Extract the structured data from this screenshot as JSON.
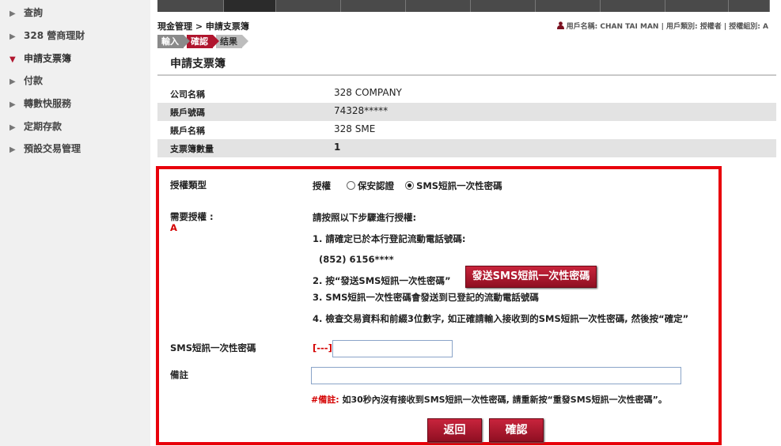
{
  "sidebar": {
    "items": [
      {
        "label": "查詢",
        "active": false
      },
      {
        "label": "328 營商理財",
        "active": false
      },
      {
        "label": "申請支票簿",
        "active": true
      },
      {
        "label": "付款",
        "active": false
      },
      {
        "label": "轉數快服務",
        "active": false
      },
      {
        "label": "定期存款",
        "active": false
      },
      {
        "label": "預設交易管理",
        "active": false
      }
    ]
  },
  "header": {
    "breadcrumb": "現金管理 > 申請支票簿",
    "user_info": "用戶名稱: CHAN TAI MAN | 用戶類別: 授權者 | 授權組別: A"
  },
  "steps": [
    "輸入",
    "確認",
    "结果"
  ],
  "page_title": "申請支票簿",
  "info": [
    {
      "label": "公司名稱",
      "value": "328 COMPANY"
    },
    {
      "label": "賬戶號碼",
      "value": "74328*****"
    },
    {
      "label": "賬戶名稱",
      "value": "328 SME"
    },
    {
      "label": "支票簿數量",
      "value": "1"
    }
  ],
  "auth": {
    "type_label": "授權類型",
    "type_prefix": "授權",
    "option_token": "保安認證",
    "option_sms": "SMS短訊一次性密碼",
    "required_label": "需要授權 :",
    "required_group": "A",
    "instructions_title": "請按照以下步驟進行授權:",
    "step1": "1. 請確定已於本行登記流動電話號碼:",
    "phone": "(852) 6156****",
    "step2": "2. 按“發送SMS短訊一次性密碼”",
    "send_button": "發送SMS短訊一次性密碼",
    "step3": "3. SMS短訊一次性密碼會發送到已登記的流動電話號碼",
    "step4": "4. 檢查交易資料和前綴3位數字, 如正確請輸入接收到的SMS短訊一次性密碼, 然後按“確定”",
    "otp_label": "SMS短訊一次性密碼",
    "otp_prefix": "[---]",
    "otp_value": "",
    "remark_label": "備註",
    "remark_value": "",
    "note_prefix": "#備註:",
    "note_text": "如30秒內沒有接收到SMS短訊一次性密碼, 請重新按“重發SMS短訊一次性密碼”。",
    "back_button": "返回",
    "confirm_button": "確認"
  },
  "colors": {
    "accent": "#b0152e",
    "frame": "#e8000b"
  }
}
